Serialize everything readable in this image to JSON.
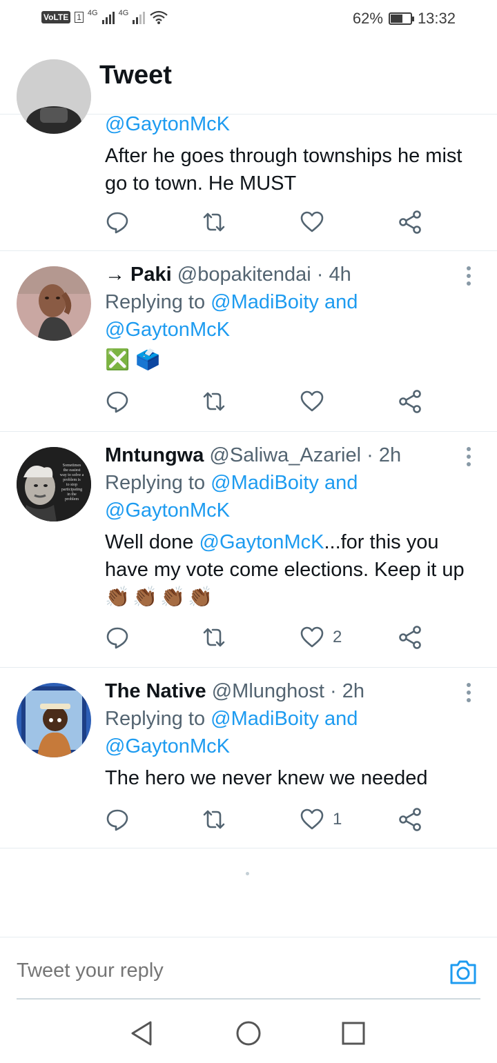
{
  "status_bar": {
    "volte": "VoLTE",
    "sim": "1",
    "net1": "4G",
    "net2": "4G",
    "battery_pct": "62%",
    "battery_level": 0.62,
    "time": "13:32"
  },
  "header": {
    "title": "Tweet"
  },
  "tweets": [
    {
      "reply_to": "@GaytonMcK",
      "text": "After he goes through townships he mist go to town. He MUST",
      "likes": ""
    },
    {
      "name": "→ Paki",
      "handle": "@bopakitendai",
      "dot": "·",
      "time": "4h",
      "replying_prefix": "Replying to",
      "reply_to_1": "@MadiBoity and",
      "reply_to_2": "@GaytonMcK",
      "text": "❎ 🗳️",
      "likes": ""
    },
    {
      "name": "Mntungwa",
      "handle": "@Saliwa_Azariel",
      "dot": "·",
      "time": "2h",
      "replying_prefix": "Replying to",
      "reply_to_1": "@MadiBoity and",
      "reply_to_2": "@GaytonMcK",
      "text_prefix": "Well done",
      "text_mention": "@GaytonMcK",
      "text_rest": "...for this you have my vote come elections. Keep it up",
      "text_emoji": "👏🏾👏🏾👏🏾👏🏾",
      "likes": "2"
    },
    {
      "name": "The Native",
      "handle": "@Mlunghost",
      "dot": "·",
      "time": "2h",
      "replying_prefix": "Replying to",
      "reply_to_1": "@MadiBoity and",
      "reply_to_2": "@GaytonMcK",
      "text": "The hero we never knew we needed",
      "likes": "1"
    }
  ],
  "avatar_quote": [
    "Sometimes",
    "the easiest",
    "way to solve a",
    "problem is",
    "to stop",
    "participating",
    "in the",
    "problem"
  ],
  "reply_bar": {
    "placeholder": "Tweet your reply"
  },
  "icons": [
    "back-arrow-icon",
    "reply-icon",
    "retweet-icon",
    "like-icon",
    "share-icon",
    "more-icon",
    "camera-icon"
  ],
  "colors": {
    "accent": "#1d9bf0",
    "text": "#0f1419",
    "muted": "#536471"
  }
}
